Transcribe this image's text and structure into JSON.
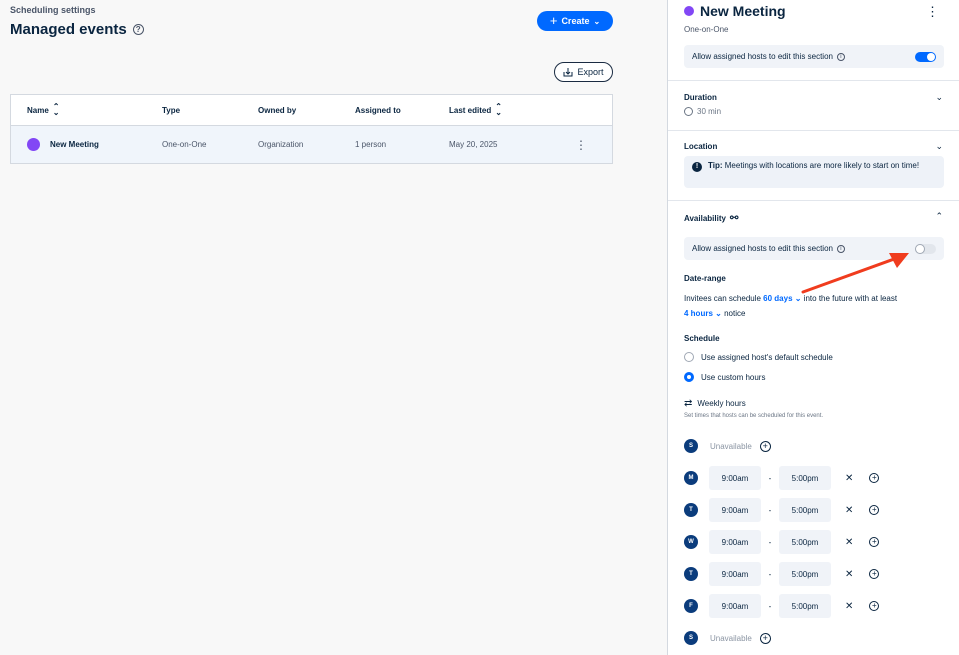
{
  "main": {
    "breadcrumb": "Scheduling settings",
    "title": "Managed events",
    "help_icon": "?",
    "create_label": "Create",
    "export_label": "Export",
    "table": {
      "headers": {
        "name": "Name",
        "type": "Type",
        "owned_by": "Owned by",
        "assigned_to": "Assigned to",
        "last_edited": "Last edited"
      },
      "rows": [
        {
          "name": "New Meeting",
          "type": "One-on-One",
          "owned_by": "Organization",
          "assigned_to": "1 person",
          "last_edited": "May 20, 2025",
          "color": "#8247f5"
        }
      ]
    }
  },
  "panel": {
    "title": "New Meeting",
    "subtitle": "One-on-One",
    "allow_hosts_label": "Allow assigned hosts to edit this section",
    "allow_hosts_top_enabled": true,
    "duration": {
      "title": "Duration",
      "value": "30 min"
    },
    "location": {
      "title": "Location",
      "tip_label": "Tip:",
      "tip_text": "Meetings with locations are more likely to start on time!"
    },
    "availability": {
      "title": "Availability",
      "allow_hosts_enabled": false,
      "date_range_title": "Date-range",
      "date_range_prefix": "Invitees can schedule",
      "date_range_days": "60 days",
      "date_range_mid": "into the future with at least",
      "notice_value": "4 hours",
      "notice_suffix": "notice",
      "schedule_title": "Schedule",
      "schedule_options": [
        "Use assigned host's default schedule",
        "Use custom hours"
      ],
      "schedule_selected": 1,
      "weekly_title": "Weekly hours",
      "weekly_help": "Set times that hosts can be scheduled for this event.",
      "unavailable_label": "Unavailable",
      "days": [
        {
          "letter": "S",
          "available": false
        },
        {
          "letter": "M",
          "available": true,
          "start": "9:00am",
          "end": "5:00pm"
        },
        {
          "letter": "T",
          "available": true,
          "start": "9:00am",
          "end": "5:00pm"
        },
        {
          "letter": "W",
          "available": true,
          "start": "9:00am",
          "end": "5:00pm"
        },
        {
          "letter": "T",
          "available": true,
          "start": "9:00am",
          "end": "5:00pm"
        },
        {
          "letter": "F",
          "available": true,
          "start": "9:00am",
          "end": "5:00pm"
        },
        {
          "letter": "S",
          "available": false
        }
      ]
    }
  },
  "colors": {
    "accent": "#0069ff",
    "brand_purple": "#8247f5",
    "annotation_arrow": "#f03c1e"
  }
}
